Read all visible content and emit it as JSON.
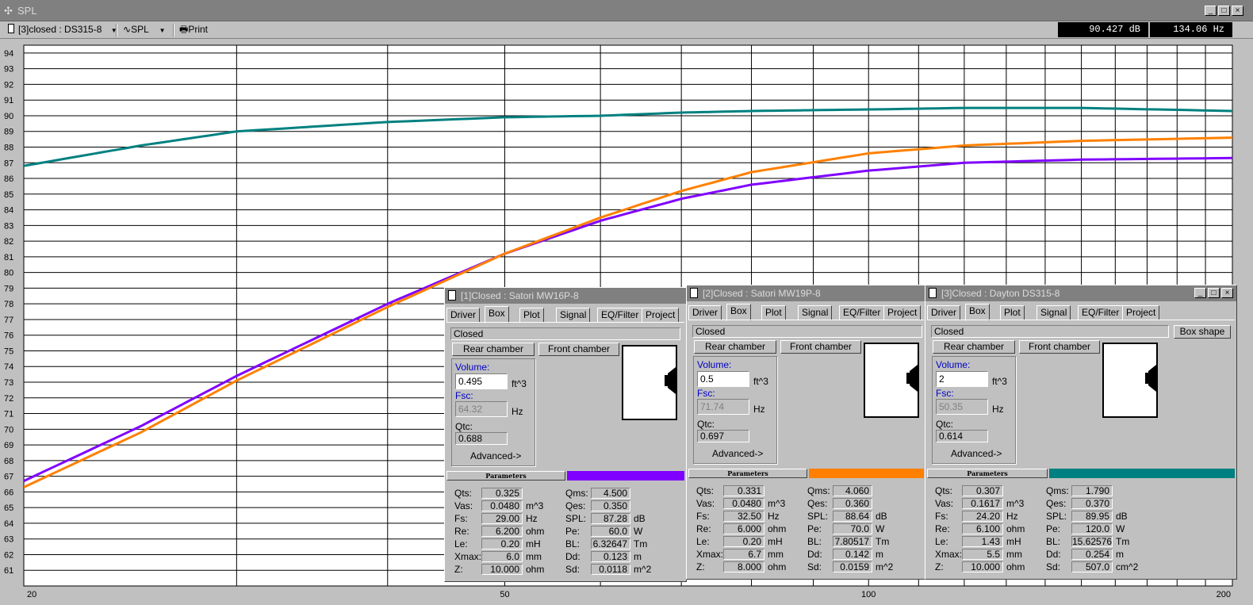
{
  "window": {
    "title": "SPL"
  },
  "toolbar": {
    "project_selector": "[3]closed : DS315-8",
    "plot_selector": "SPL",
    "print_label": "Print",
    "readout_db": "90.427 dB",
    "readout_hz": "134.06 Hz"
  },
  "chart_data": {
    "type": "line",
    "x_scale": "log",
    "xlim": [
      20,
      200
    ],
    "ylim": [
      60,
      95
    ],
    "x_tick_labels": [
      "20",
      "50",
      "100",
      "200"
    ],
    "y_ticks": [
      61,
      62,
      63,
      64,
      65,
      66,
      67,
      68,
      69,
      70,
      71,
      72,
      73,
      74,
      75,
      76,
      77,
      78,
      79,
      80,
      81,
      82,
      83,
      84,
      85,
      86,
      87,
      88,
      89,
      90,
      91,
      92,
      93,
      94
    ],
    "grid": true,
    "series": [
      {
        "color": "#8000ff",
        "x": [
          20,
          25,
          30,
          40,
          50,
          60,
          70,
          80,
          100,
          120,
          150,
          200
        ],
        "y": [
          66.7,
          70.2,
          73.4,
          78.0,
          81.2,
          83.3,
          84.7,
          85.6,
          86.5,
          87.0,
          87.2,
          87.3
        ]
      },
      {
        "color": "#ff8000",
        "x": [
          20,
          25,
          30,
          40,
          50,
          60,
          70,
          80,
          100,
          120,
          150,
          200
        ],
        "y": [
          66.3,
          69.8,
          73.1,
          77.8,
          81.2,
          83.5,
          85.2,
          86.4,
          87.6,
          88.1,
          88.4,
          88.6
        ]
      },
      {
        "color": "#008080",
        "x": [
          20,
          25,
          30,
          40,
          50,
          60,
          70,
          80,
          100,
          120,
          150,
          200
        ],
        "y": [
          86.8,
          88.1,
          89.0,
          89.6,
          89.9,
          90.0,
          90.2,
          90.3,
          90.4,
          90.5,
          90.5,
          90.3
        ]
      }
    ]
  },
  "panels": [
    {
      "title": "[1]Closed : Satori MW16P-8",
      "tabs": [
        "Driver",
        "Box",
        "Plot",
        "Signal",
        "EQ/Filter",
        "Project"
      ],
      "box_type": "Closed",
      "rear_chamber": "Rear chamber",
      "front_chamber": "Front chamber",
      "volume_label": "Volume:",
      "volume": "0.495",
      "volume_unit": "ft^3",
      "fsc_label": "Fsc:",
      "fsc": "64.32",
      "fsc_unit": "Hz",
      "qtc_label": "Qtc:",
      "qtc": "0.688",
      "advanced": "Advanced->",
      "params_label": "Parameters",
      "color": "#8000ff",
      "left_params": [
        {
          "label": "Qts:",
          "value": "0.325",
          "unit": ""
        },
        {
          "label": "Vas:",
          "value": "0.0480",
          "unit": "m^3"
        },
        {
          "label": "Fs:",
          "value": "29.00",
          "unit": "Hz"
        },
        {
          "label": "Re:",
          "value": "6.200",
          "unit": "ohm"
        },
        {
          "label": "Le:",
          "value": "0.20",
          "unit": "mH"
        },
        {
          "label": "Xmax:",
          "value": "6.0",
          "unit": "mm"
        },
        {
          "label": "Z:",
          "value": "10.000",
          "unit": "ohm"
        }
      ],
      "right_params": [
        {
          "label": "Qms:",
          "value": "4.500",
          "unit": ""
        },
        {
          "label": "Qes:",
          "value": "0.350",
          "unit": ""
        },
        {
          "label": "SPL:",
          "value": "87.28",
          "unit": "dB"
        },
        {
          "label": "Pe:",
          "value": "60.0",
          "unit": "W"
        },
        {
          "label": "BL:",
          "value": "6.32647",
          "unit": "Tm"
        },
        {
          "label": "Dd:",
          "value": "0.123",
          "unit": "m"
        },
        {
          "label": "Sd:",
          "value": "0.0118",
          "unit": "m^2"
        }
      ]
    },
    {
      "title": "[2]Closed : Satori MW19P-8",
      "tabs": [
        "Driver",
        "Box",
        "Plot",
        "Signal",
        "EQ/Filter",
        "Project"
      ],
      "box_type": "Closed",
      "rear_chamber": "Rear chamber",
      "front_chamber": "Front chamber",
      "volume_label": "Volume:",
      "volume": "0.5",
      "volume_unit": "ft^3",
      "fsc_label": "Fsc:",
      "fsc": "71.74",
      "fsc_unit": "Hz",
      "qtc_label": "Qtc:",
      "qtc": "0.697",
      "advanced": "Advanced->",
      "params_label": "Parameters",
      "color": "#ff8000",
      "left_params": [
        {
          "label": "Qts:",
          "value": "0.331",
          "unit": ""
        },
        {
          "label": "Vas:",
          "value": "0.0480",
          "unit": "m^3"
        },
        {
          "label": "Fs:",
          "value": "32.50",
          "unit": "Hz"
        },
        {
          "label": "Re:",
          "value": "6.000",
          "unit": "ohm"
        },
        {
          "label": "Le:",
          "value": "0.20",
          "unit": "mH"
        },
        {
          "label": "Xmax:",
          "value": "6.7",
          "unit": "mm"
        },
        {
          "label": "Z:",
          "value": "8.000",
          "unit": "ohm"
        }
      ],
      "right_params": [
        {
          "label": "Qms:",
          "value": "4.060",
          "unit": ""
        },
        {
          "label": "Qes:",
          "value": "0.360",
          "unit": ""
        },
        {
          "label": "SPL:",
          "value": "88.64",
          "unit": "dB"
        },
        {
          "label": "Pe:",
          "value": "70.0",
          "unit": "W"
        },
        {
          "label": "BL:",
          "value": "7.80517",
          "unit": "Tm"
        },
        {
          "label": "Dd:",
          "value": "0.142",
          "unit": "m"
        },
        {
          "label": "Sd:",
          "value": "0.0159",
          "unit": "m^2"
        }
      ]
    },
    {
      "title": "[3]Closed : Dayton DS315-8",
      "tabs": [
        "Driver",
        "Box",
        "Plot",
        "Signal",
        "EQ/Filter",
        "Project"
      ],
      "box_type": "Closed",
      "box_shape": "Box shape",
      "rear_chamber": "Rear chamber",
      "front_chamber": "Front chamber",
      "volume_label": "Volume:",
      "volume": "2",
      "volume_unit": "ft^3",
      "fsc_label": "Fsc:",
      "fsc": "50.35",
      "fsc_unit": "Hz",
      "qtc_label": "Qtc:",
      "qtc": "0.614",
      "advanced": "Advanced->",
      "params_label": "Parameters",
      "color": "#008080",
      "left_params": [
        {
          "label": "Qts:",
          "value": "0.307",
          "unit": ""
        },
        {
          "label": "Vas:",
          "value": "0.1617",
          "unit": "m^3"
        },
        {
          "label": "Fs:",
          "value": "24.20",
          "unit": "Hz"
        },
        {
          "label": "Re:",
          "value": "6.100",
          "unit": "ohm"
        },
        {
          "label": "Le:",
          "value": "1.43",
          "unit": "mH"
        },
        {
          "label": "Xmax:",
          "value": "5.5",
          "unit": "mm"
        },
        {
          "label": "Z:",
          "value": "10.000",
          "unit": "ohm"
        }
      ],
      "right_params": [
        {
          "label": "Qms:",
          "value": "1.790",
          "unit": ""
        },
        {
          "label": "Qes:",
          "value": "0.370",
          "unit": ""
        },
        {
          "label": "SPL:",
          "value": "89.95",
          "unit": "dB"
        },
        {
          "label": "Pe:",
          "value": "120.0",
          "unit": "W"
        },
        {
          "label": "BL:",
          "value": "15.62576",
          "unit": "Tm"
        },
        {
          "label": "Dd:",
          "value": "0.254",
          "unit": "m"
        },
        {
          "label": "Sd:",
          "value": "507.0",
          "unit": "cm^2"
        }
      ]
    }
  ]
}
